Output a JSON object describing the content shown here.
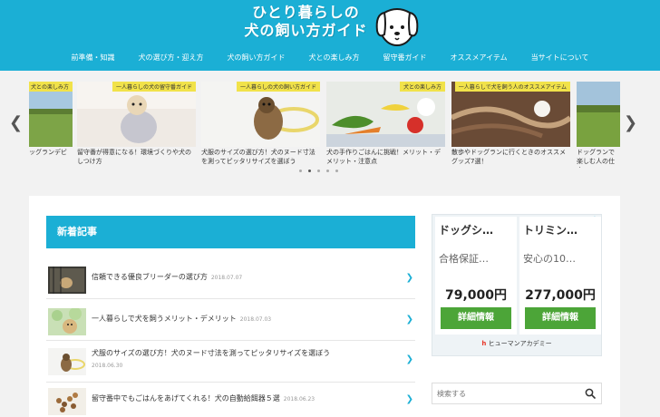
{
  "site": {
    "title_line1": "ひとり暮らしの",
    "title_line2": "犬の飼い方ガイド"
  },
  "nav": [
    "前準備・知識",
    "犬の選び方・迎え方",
    "犬の飼い方ガイド",
    "犬との楽しみ方",
    "留守番ガイド",
    "オススメアイテム",
    "当サイトについて"
  ],
  "carousel": {
    "slides": [
      {
        "tag": "犬との楽しみ方",
        "title": "ッグランデビ"
      },
      {
        "tag": "一人暮らしの犬の留守番ガイド",
        "title": "留守番が得意になる！環境づくりや犬のしつけ方"
      },
      {
        "tag": "一人暮らしの犬の飼い方ガイド",
        "title": "犬服のサイズの選び方！犬のヌード寸法を測ってピッタリサイズを選ぼう"
      },
      {
        "tag": "犬との楽しみ方",
        "title": "犬の手作りごはんに挑戦！メリット・デメリット・注意点"
      },
      {
        "tag": "一人暮らしで犬を飼う人のオススメアイテム",
        "title": "散歩やドッグランに行くときのオススメグッズ7選！"
      },
      {
        "tag": "",
        "title": "ドッグランで楽しむ人の仕方"
      }
    ],
    "dot_count": 5,
    "active_dot": 1
  },
  "new_articles": {
    "heading": "新着記事",
    "items": [
      {
        "title": "信頼できる優良ブリーダーの選び方",
        "date": "2018.07.07"
      },
      {
        "title": "一人暮らしで犬を飼うメリット・デメリット",
        "date": "2018.07.03"
      },
      {
        "title": "犬服のサイズの選び方！犬のヌード寸法を測ってピッタリサイズを選ぼう",
        "date": "2018.06.30"
      },
      {
        "title": "留守番中でもごはんをあげてくれる！犬の自動給餌器５選",
        "date": "2018.06.23"
      }
    ]
  },
  "ad": {
    "col1": {
      "name": "ドッグシ…",
      "sub": "合格保証…",
      "price": "79,000円",
      "button": "詳細情報"
    },
    "col2": {
      "name": "トリミン…",
      "sub": "安心の10…",
      "price": "277,000円",
      "button": "詳細情報"
    },
    "brand": "ヒューマンアカデミー",
    "brand_mark": "h"
  },
  "search": {
    "placeholder": "検索する"
  },
  "colors": {
    "brand": "#1bafd5",
    "tag": "#f1e24a",
    "button": "#4ca538"
  }
}
